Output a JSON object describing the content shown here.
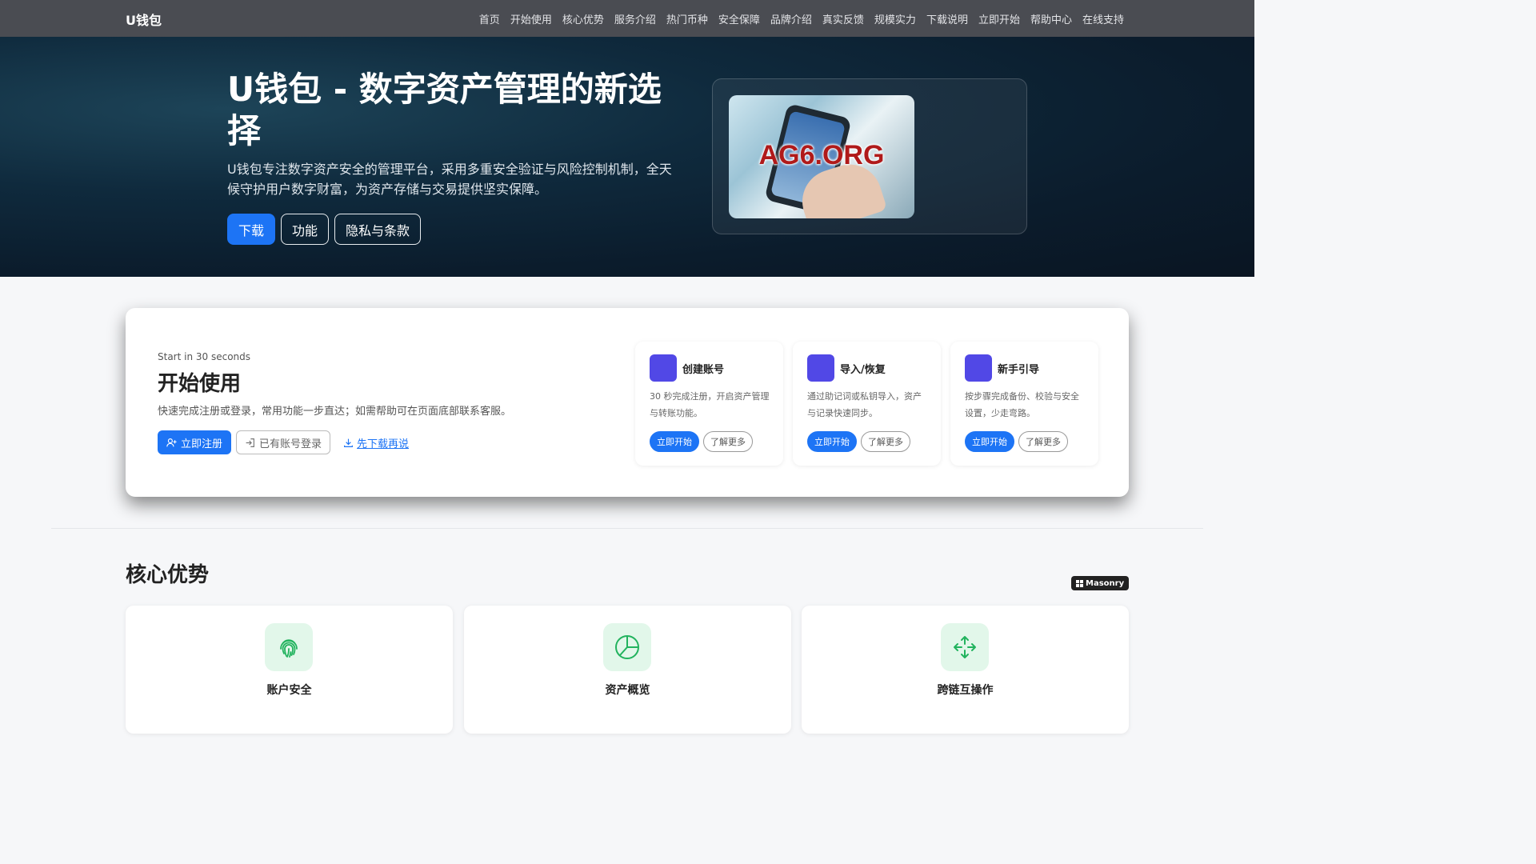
{
  "nav": {
    "brand": "U钱包",
    "links": [
      "首页",
      "开始使用",
      "核心优势",
      "服务介绍",
      "热门币种",
      "安全保障",
      "品牌介绍",
      "真实反馈",
      "规模实力",
      "下载说明",
      "立即开始",
      "帮助中心",
      "在线支持"
    ]
  },
  "hero": {
    "title": "U钱包 - 数字资产管理的新选择",
    "description": "U钱包专注数字资产安全的管理平台，采用多重安全验证与风险控制机制，全天候守护用户数字财富，为资产存储与交易提供坚实保障。",
    "buttons": [
      "下载",
      "功能",
      "隐私与条款"
    ],
    "image_text": "AG6.ORG"
  },
  "start": {
    "eyebrow": "Start in 30 seconds",
    "title": "开始使用",
    "description": "快速完成注册或登录，常用功能一步直达；如需帮助可在页面底部联系客服。",
    "register": "立即注册",
    "login": "已有账号登录",
    "download_link": "先下载再说",
    "features": [
      {
        "title": "创建账号",
        "desc": "30 秒完成注册，开启资产管理与转账功能。",
        "primary": "立即开始",
        "secondary": "了解更多"
      },
      {
        "title": "导入/恢复",
        "desc": "通过助记词或私钥导入，资产与记录快速同步。",
        "primary": "立即开始",
        "secondary": "了解更多"
      },
      {
        "title": "新手引导",
        "desc": "按步骤完成备份、校验与安全设置，少走弯路。",
        "primary": "立即开始",
        "secondary": "了解更多"
      }
    ]
  },
  "core": {
    "title": "核心优势",
    "badge": "Masonry",
    "cards": [
      {
        "label": "账户安全",
        "icon": "fingerprint-icon"
      },
      {
        "label": "资产概览",
        "icon": "pie-chart-icon"
      },
      {
        "label": "跨链互操作",
        "icon": "arrows-move-icon"
      }
    ],
    "icon_color": "#22b35e"
  },
  "colors": {
    "accent": "#1d74f5",
    "feature_icon": "#5148e6"
  }
}
